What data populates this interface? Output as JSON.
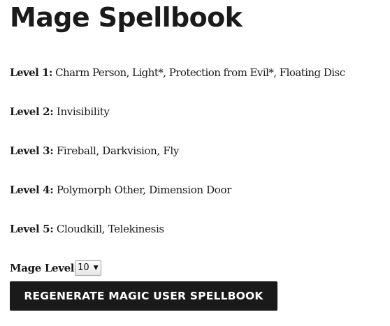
{
  "page": {
    "title": "Mage Spellbook"
  },
  "spellbook": {
    "levels": [
      {
        "label": "Level 1:",
        "spells": "Charm Person, Light*, Protection from Evil*, Floating Disc"
      },
      {
        "label": "Level 2:",
        "spells": "Invisibility"
      },
      {
        "label": "Level 3:",
        "spells": "Fireball, Darkvision, Fly"
      },
      {
        "label": "Level 4:",
        "spells": "Polymorph Other, Dimension Door"
      },
      {
        "label": "Level 5:",
        "spells": "Cloudkill, Telekinesis"
      }
    ]
  },
  "controls": {
    "mage_level_label": "Mage Level",
    "mage_level_value": "10",
    "regenerate_label": "REGENERATE MAGIC USER SPELLBOOK"
  }
}
